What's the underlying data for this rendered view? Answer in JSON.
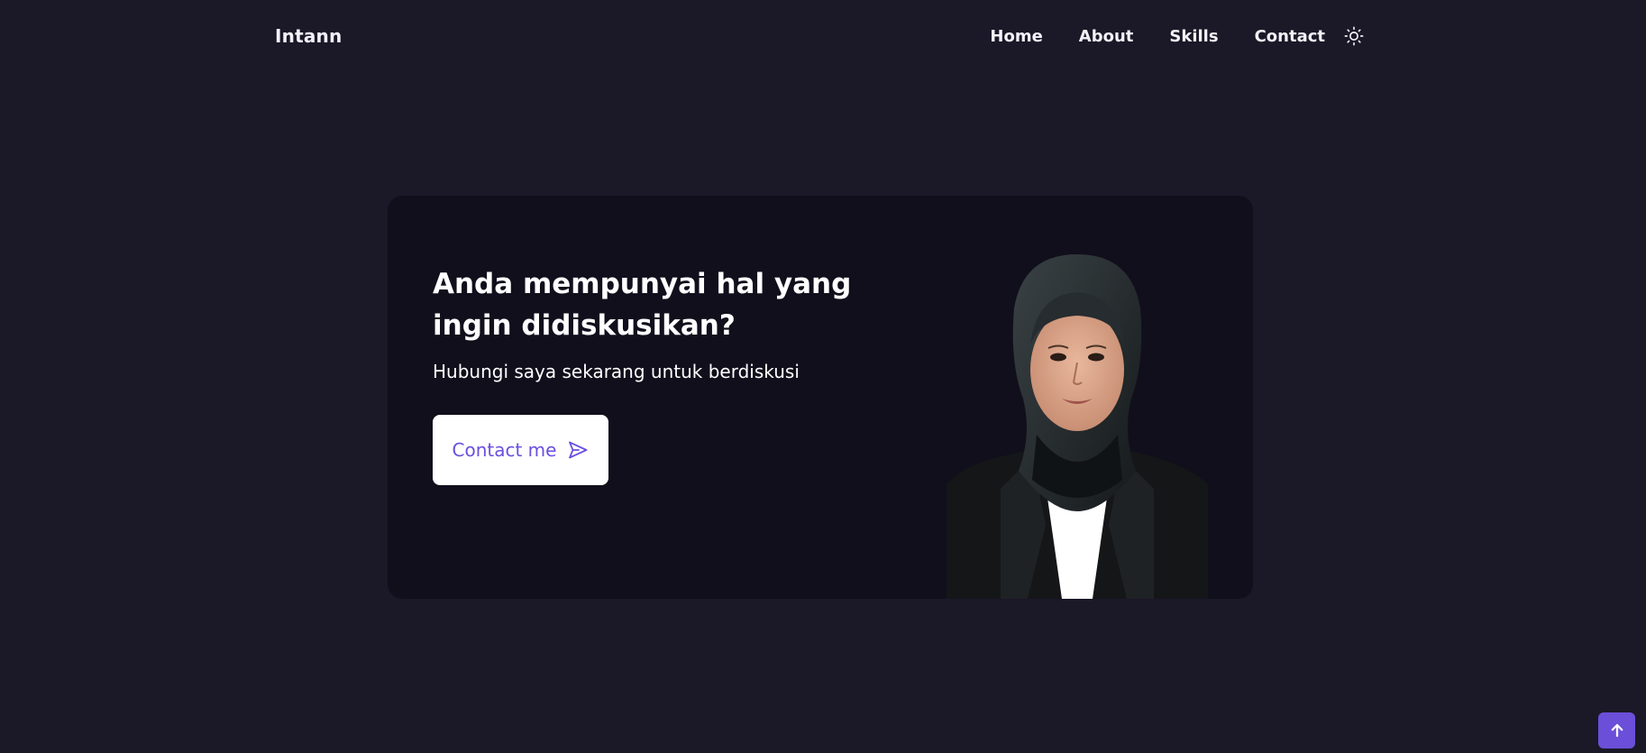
{
  "header": {
    "logo": "Intann",
    "nav": {
      "home": "Home",
      "about": "About",
      "skills": "Skills",
      "contact": "Contact"
    },
    "theme_toggle_icon": "sun-icon"
  },
  "contact_section": {
    "title": "Anda mempunyai hal yang ingin didiskusikan?",
    "subtitle": "Hubungi saya sekarang untuk berdiskusi",
    "button_label": "Contact me",
    "button_icon": "send-icon",
    "portrait": "profile-photo"
  },
  "scroll_top": {
    "icon": "arrow-up-icon"
  },
  "colors": {
    "background": "#1b1828",
    "card_background": "#110f1c",
    "accent": "#6b4fe0",
    "text": "#ffffff"
  }
}
